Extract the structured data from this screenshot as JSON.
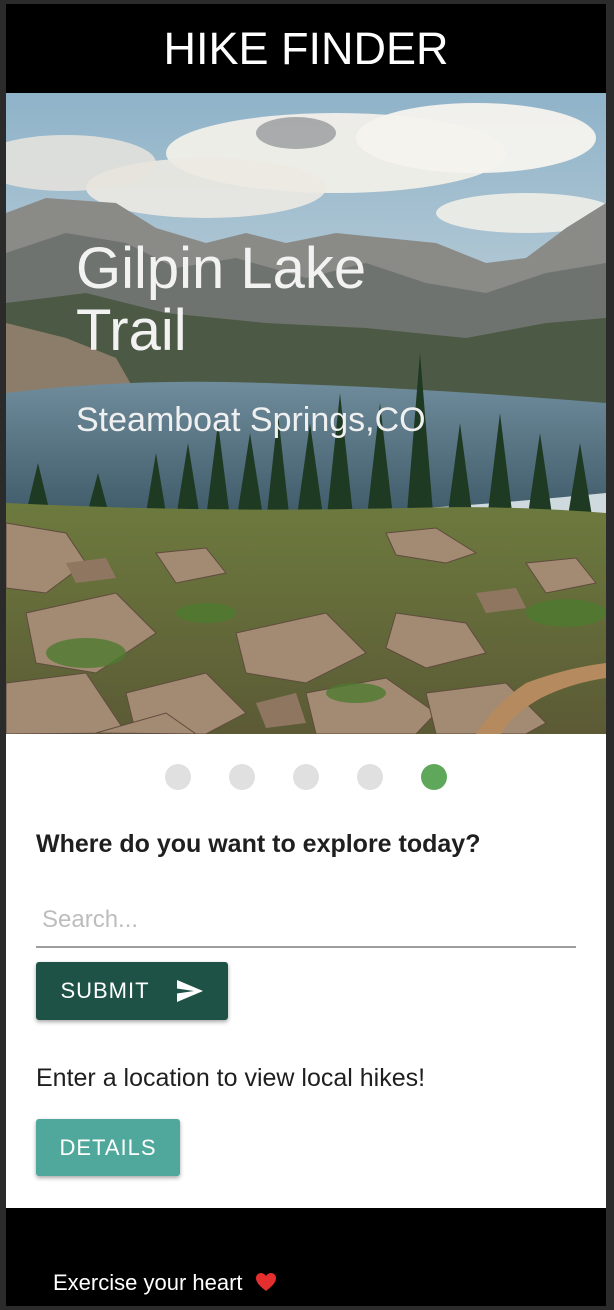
{
  "appbar": {
    "title": "HIKE FINDER"
  },
  "hero": {
    "title": "Gilpin Lake Trail",
    "subtitle": "Steamboat Springs,CO"
  },
  "carousel": {
    "count": 5,
    "active_index": 4,
    "active_color": "#5fa85b",
    "inactive_color": "#e0e0e0"
  },
  "search": {
    "question": "Where do you want to explore today?",
    "placeholder": "Search...",
    "value": "",
    "submit_label": "SUBMIT",
    "submit_icon": "send-icon"
  },
  "info": {
    "hint": "Enter a location to view local hikes!",
    "details_label": "DETAILS"
  },
  "footer": {
    "text": "Exercise your heart",
    "icon": "heart-icon"
  },
  "colors": {
    "appbar": "#000000",
    "submit_button": "#1e5247",
    "details_button": "#4fa89b",
    "footer": "#000000"
  }
}
